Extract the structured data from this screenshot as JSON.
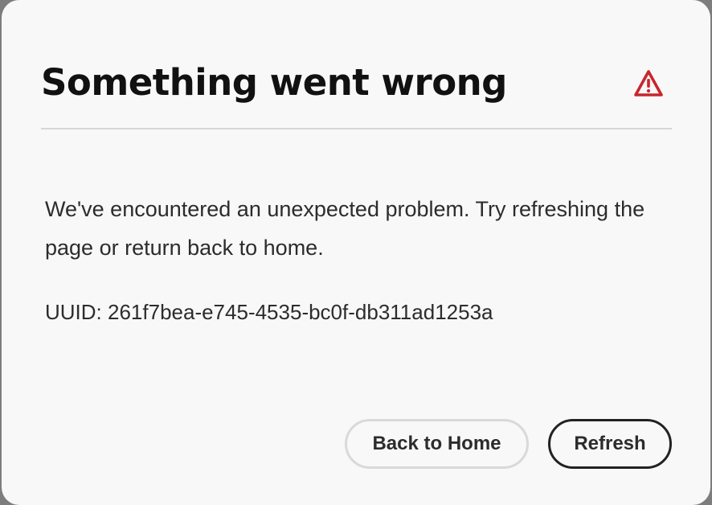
{
  "dialog": {
    "title": "Something went wrong",
    "alert_icon": "alert-triangle-icon",
    "message": "We've encountered an unexpected problem. Try refreshing the page or return back to home.",
    "uuid_text": "UUID: 261f7bea-e745-4535-bc0f-db311ad1253a",
    "buttons": {
      "back_home_label": "Back to Home",
      "refresh_label": "Refresh"
    }
  },
  "colors": {
    "alert": "#c9252d",
    "title": "#111111",
    "body_text": "#2c2c2c",
    "dialog_bg": "#f8f8f8"
  }
}
